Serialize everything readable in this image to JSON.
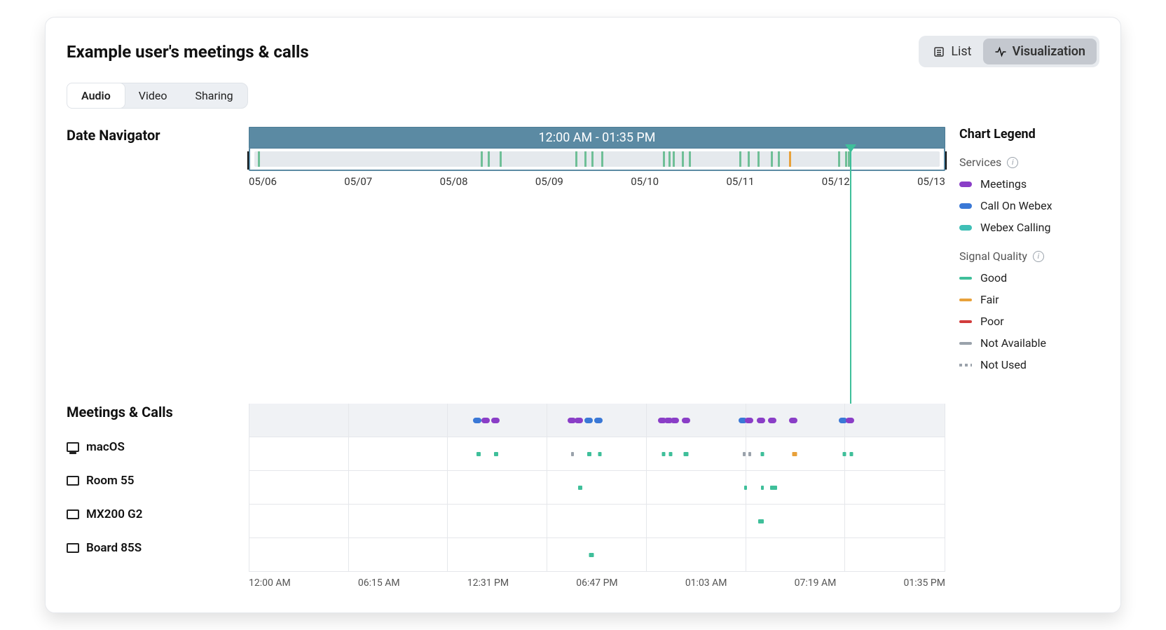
{
  "title": "Example user's meetings & calls",
  "view_toggle": {
    "list": "List",
    "visualization": "Visualization",
    "active": "visualization"
  },
  "tabs": {
    "items": [
      "Audio",
      "Video",
      "Sharing"
    ],
    "active": 0
  },
  "date_navigator": {
    "title": "Date Navigator",
    "range_label": "12:00 AM - 01:35 PM",
    "axis": [
      "05/06",
      "05/07",
      "05/08",
      "05/09",
      "05/10",
      "05/11",
      "05/12",
      "05/13"
    ],
    "caret_position_pct": 86.6,
    "ticks": [
      {
        "pos": 0.5,
        "color": "good"
      },
      {
        "pos": 33.0,
        "color": "good"
      },
      {
        "pos": 34.0,
        "color": "good"
      },
      {
        "pos": 35.8,
        "color": "good"
      },
      {
        "pos": 46.8,
        "color": "good"
      },
      {
        "pos": 48.2,
        "color": "good"
      },
      {
        "pos": 49.2,
        "color": "good"
      },
      {
        "pos": 50.6,
        "color": "good"
      },
      {
        "pos": 59.6,
        "color": "good"
      },
      {
        "pos": 60.4,
        "color": "good"
      },
      {
        "pos": 61.0,
        "color": "good"
      },
      {
        "pos": 62.4,
        "color": "good"
      },
      {
        "pos": 63.4,
        "color": "good"
      },
      {
        "pos": 70.8,
        "color": "good"
      },
      {
        "pos": 72.0,
        "color": "good"
      },
      {
        "pos": 73.4,
        "color": "good"
      },
      {
        "pos": 75.4,
        "color": "good"
      },
      {
        "pos": 76.4,
        "color": "good"
      },
      {
        "pos": 78.0,
        "color": "fair"
      },
      {
        "pos": 85.2,
        "color": "good"
      },
      {
        "pos": 86.2,
        "color": "good"
      },
      {
        "pos": 86.6,
        "color": "good"
      }
    ]
  },
  "legend": {
    "title": "Chart Legend",
    "services_label": "Services",
    "services": [
      {
        "label": "Meetings",
        "color": "purple"
      },
      {
        "label": "Call On Webex",
        "color": "blue"
      },
      {
        "label": "Webex Calling",
        "color": "teal"
      }
    ],
    "quality_label": "Signal Quality",
    "quality": [
      {
        "label": "Good",
        "color": "good"
      },
      {
        "label": "Fair",
        "color": "fair"
      },
      {
        "label": "Poor",
        "color": "poor"
      },
      {
        "label": "Not Available",
        "color": "na"
      },
      {
        "label": "Not Used",
        "color": "dots"
      }
    ]
  },
  "meetings_calls": {
    "title": "Meetings & Calls",
    "devices": [
      {
        "label": "macOS",
        "icon": "monitor"
      },
      {
        "label": "Room 55",
        "icon": "screen"
      },
      {
        "label": "MX200 G2",
        "icon": "screen"
      },
      {
        "label": "Board 85S",
        "icon": "screen"
      }
    ],
    "time_axis": [
      "12:00 AM",
      "06:15 AM",
      "12:31 PM",
      "06:47 PM",
      "01:03 AM",
      "07:19 AM",
      "01:35 PM"
    ],
    "header_dots": [
      {
        "pos": 32.8,
        "color": "blue"
      },
      {
        "pos": 34.0,
        "color": "purple"
      },
      {
        "pos": 35.4,
        "color": "purple"
      },
      {
        "pos": 46.4,
        "color": "purple"
      },
      {
        "pos": 47.4,
        "color": "purple"
      },
      {
        "pos": 48.8,
        "color": "blue"
      },
      {
        "pos": 50.2,
        "color": "blue"
      },
      {
        "pos": 59.4,
        "color": "purple"
      },
      {
        "pos": 60.3,
        "color": "purple"
      },
      {
        "pos": 61.2,
        "color": "purple"
      },
      {
        "pos": 62.8,
        "color": "purple"
      },
      {
        "pos": 71.0,
        "color": "blue"
      },
      {
        "pos": 71.9,
        "color": "purple"
      },
      {
        "pos": 73.6,
        "color": "purple"
      },
      {
        "pos": 75.2,
        "color": "purple"
      },
      {
        "pos": 78.2,
        "color": "purple"
      },
      {
        "pos": 85.4,
        "color": "blue"
      },
      {
        "pos": 86.4,
        "color": "purple"
      }
    ],
    "device_rows": [
      [
        {
          "pos": 33.0,
          "w": 6,
          "color": "good"
        },
        {
          "pos": 35.5,
          "w": 6,
          "color": "good"
        },
        {
          "pos": 46.5,
          "w": 4,
          "color": "na"
        },
        {
          "pos": 48.9,
          "w": 6,
          "color": "good"
        },
        {
          "pos": 50.4,
          "w": 5,
          "color": "good"
        },
        {
          "pos": 59.6,
          "w": 5,
          "color": "good"
        },
        {
          "pos": 60.6,
          "w": 5,
          "color": "good"
        },
        {
          "pos": 62.8,
          "w": 7,
          "color": "good"
        },
        {
          "pos": 71.2,
          "w": 4,
          "color": "na"
        },
        {
          "pos": 72.0,
          "w": 4,
          "color": "na"
        },
        {
          "pos": 73.8,
          "w": 5,
          "color": "good"
        },
        {
          "pos": 78.4,
          "w": 7,
          "color": "fair"
        },
        {
          "pos": 85.6,
          "w": 5,
          "color": "good"
        },
        {
          "pos": 86.6,
          "w": 5,
          "color": "good"
        }
      ],
      [
        {
          "pos": 47.6,
          "w": 6,
          "color": "good"
        },
        {
          "pos": 71.4,
          "w": 4,
          "color": "good"
        },
        {
          "pos": 73.8,
          "w": 4,
          "color": "good"
        },
        {
          "pos": 75.4,
          "w": 10,
          "color": "good"
        }
      ],
      [
        {
          "pos": 73.6,
          "w": 8,
          "color": "good"
        }
      ],
      [
        {
          "pos": 49.2,
          "w": 7,
          "color": "good"
        }
      ]
    ]
  },
  "chart_data": {
    "type": "timeline",
    "title": "Example user's meetings & calls",
    "x_range_label": "12:00 AM - 01:35 PM",
    "date_axis": [
      "05/06",
      "05/07",
      "05/08",
      "05/09",
      "05/10",
      "05/11",
      "05/12",
      "05/13"
    ],
    "time_axis": [
      "12:00 AM",
      "06:15 AM",
      "12:31 PM",
      "06:47 PM",
      "01:03 AM",
      "07:19 AM",
      "01:35 PM"
    ],
    "series": [
      {
        "name": "Meetings",
        "color": "#8a3ec7"
      },
      {
        "name": "Call On Webex",
        "color": "#3a78d6"
      },
      {
        "name": "Webex Calling",
        "color": "#3fbfb6"
      }
    ],
    "signal_quality_levels": [
      "Good",
      "Fair",
      "Poor",
      "Not Available",
      "Not Used"
    ],
    "devices": [
      "macOS",
      "Room 55",
      "MX200 G2",
      "Board 85S"
    ],
    "current_marker_pct": 86.6,
    "events_header_pct": [
      {
        "pos": 32.8,
        "type": "Call On Webex"
      },
      {
        "pos": 34.0,
        "type": "Meetings"
      },
      {
        "pos": 35.4,
        "type": "Meetings"
      },
      {
        "pos": 46.4,
        "type": "Meetings"
      },
      {
        "pos": 47.4,
        "type": "Meetings"
      },
      {
        "pos": 48.8,
        "type": "Call On Webex"
      },
      {
        "pos": 50.2,
        "type": "Call On Webex"
      },
      {
        "pos": 59.4,
        "type": "Meetings"
      },
      {
        "pos": 60.3,
        "type": "Meetings"
      },
      {
        "pos": 61.2,
        "type": "Meetings"
      },
      {
        "pos": 62.8,
        "type": "Meetings"
      },
      {
        "pos": 71.0,
        "type": "Call On Webex"
      },
      {
        "pos": 71.9,
        "type": "Meetings"
      },
      {
        "pos": 73.6,
        "type": "Meetings"
      },
      {
        "pos": 75.2,
        "type": "Meetings"
      },
      {
        "pos": 78.2,
        "type": "Meetings"
      },
      {
        "pos": 85.4,
        "type": "Call On Webex"
      },
      {
        "pos": 86.4,
        "type": "Meetings"
      }
    ],
    "device_quality_pct": {
      "macOS": [
        {
          "pos": 33.0,
          "q": "Good"
        },
        {
          "pos": 35.5,
          "q": "Good"
        },
        {
          "pos": 46.5,
          "q": "Not Available"
        },
        {
          "pos": 48.9,
          "q": "Good"
        },
        {
          "pos": 50.4,
          "q": "Good"
        },
        {
          "pos": 59.6,
          "q": "Good"
        },
        {
          "pos": 60.6,
          "q": "Good"
        },
        {
          "pos": 62.8,
          "q": "Good"
        },
        {
          "pos": 71.2,
          "q": "Not Available"
        },
        {
          "pos": 72.0,
          "q": "Not Available"
        },
        {
          "pos": 73.8,
          "q": "Good"
        },
        {
          "pos": 78.4,
          "q": "Fair"
        },
        {
          "pos": 85.6,
          "q": "Good"
        },
        {
          "pos": 86.6,
          "q": "Good"
        }
      ],
      "Room 55": [
        {
          "pos": 47.6,
          "q": "Good"
        },
        {
          "pos": 71.4,
          "q": "Good"
        },
        {
          "pos": 73.8,
          "q": "Good"
        },
        {
          "pos": 75.4,
          "q": "Good"
        }
      ],
      "MX200 G2": [
        {
          "pos": 73.6,
          "q": "Good"
        }
      ],
      "Board 85S": [
        {
          "pos": 49.2,
          "q": "Good"
        }
      ]
    }
  }
}
